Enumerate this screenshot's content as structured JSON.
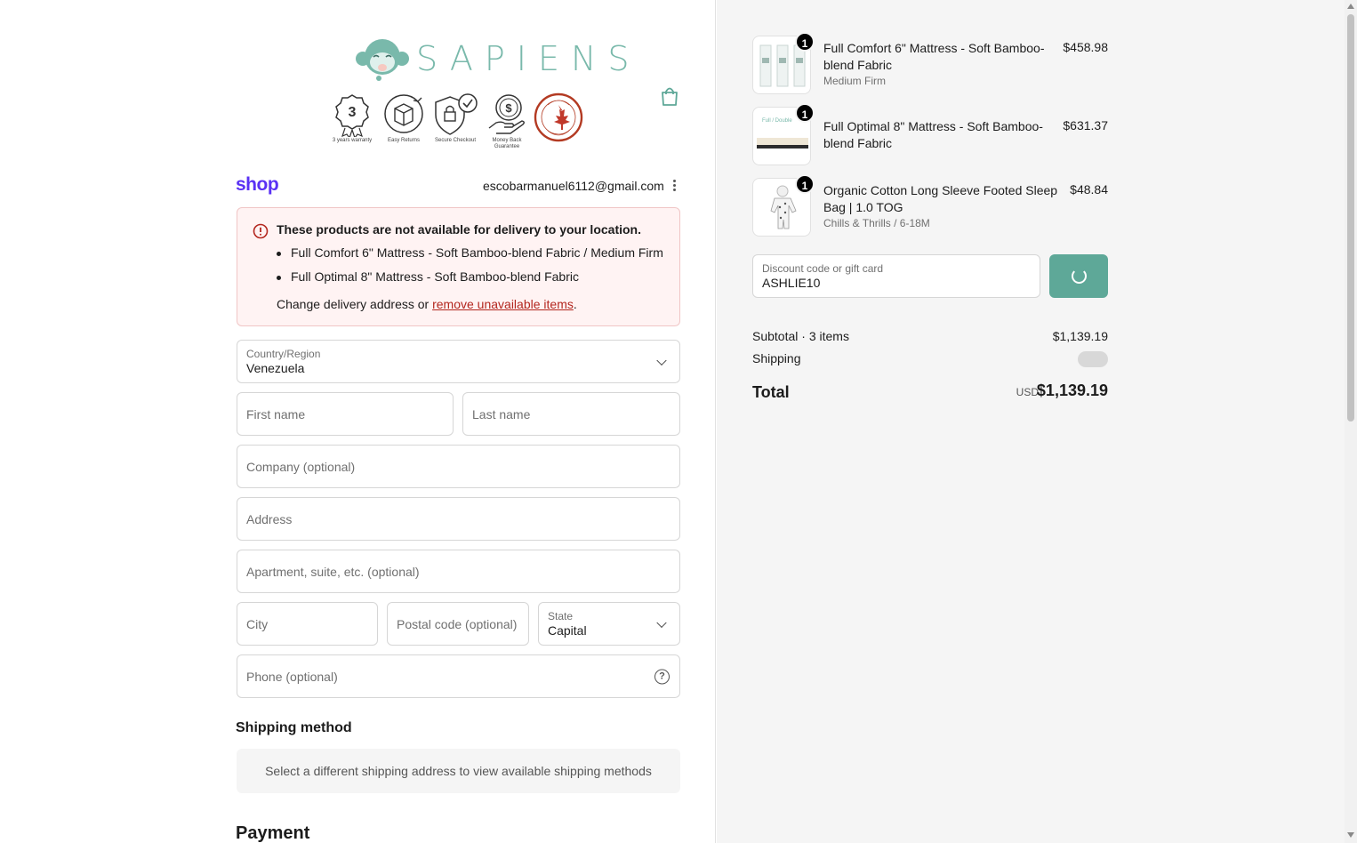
{
  "brand": {
    "name": "SAPIENS"
  },
  "badges": [
    {
      "icon": "warranty-ribbon-icon",
      "caption": "3 years warranty"
    },
    {
      "icon": "easy-returns-box-icon",
      "caption": "Easy Returns"
    },
    {
      "icon": "secure-checkout-shield-icon",
      "caption": "Secure Checkout"
    },
    {
      "icon": "money-back-hand-icon",
      "caption": "Money Back Guarantee"
    },
    {
      "icon": "made-in-canada-seal-icon",
      "caption": ""
    }
  ],
  "account": {
    "shop_label": "shop",
    "email": "escobarmanuel6112@gmail.com"
  },
  "alert": {
    "title": "These products are not available for delivery to your location.",
    "items": [
      "Full Comfort 6\" Mattress - Soft Bamboo-blend Fabric / Medium Firm",
      "Full Optimal 8\" Mattress - Soft Bamboo-blend Fabric"
    ],
    "footer_prefix": "Change delivery address or ",
    "footer_link": "remove unavailable items",
    "footer_suffix": "."
  },
  "form": {
    "country": {
      "label": "Country/Region",
      "value": "Venezuela"
    },
    "first_name": {
      "placeholder": "First name"
    },
    "last_name": {
      "placeholder": "Last name"
    },
    "company": {
      "placeholder": "Company (optional)"
    },
    "address": {
      "placeholder": "Address"
    },
    "apartment": {
      "placeholder": "Apartment, suite, etc. (optional)"
    },
    "city": {
      "placeholder": "City"
    },
    "postal": {
      "placeholder": "Postal code (optional)"
    },
    "state": {
      "label": "State",
      "value": "Capital"
    },
    "phone": {
      "placeholder": "Phone (optional)"
    }
  },
  "shipping_method": {
    "title": "Shipping method",
    "message": "Select a different shipping address to view available shipping methods"
  },
  "payment": {
    "title": "Payment"
  },
  "cart": {
    "items": [
      {
        "name": "Full Comfort 6\" Mattress - Soft Bamboo-blend Fabric",
        "variant": "Medium Firm",
        "price": "$458.98",
        "qty": "1"
      },
      {
        "name": "Full Optimal 8\" Mattress - Soft Bamboo-blend Fabric",
        "variant": "",
        "price": "$631.37",
        "qty": "1",
        "thumb_label": "Full / Double"
      },
      {
        "name": "Organic Cotton Long Sleeve Footed Sleep Bag | 1.0 TOG",
        "variant": "Chills & Thrills / 6-18M",
        "price": "$48.84",
        "qty": "1"
      }
    ],
    "discount": {
      "label": "Discount code or gift card",
      "value": "ASHLIE10"
    },
    "subtotal_label": "Subtotal · 3 items",
    "subtotal_value": "$1,139.19",
    "shipping_label": "Shipping",
    "total_label": "Total",
    "total_currency": "USD",
    "total_value": "$1,139.19"
  },
  "colors": {
    "accent": "#5ea898",
    "shop_purple": "#5a31f4",
    "error": "#b3261e",
    "brand_mint": "#79b9ab"
  }
}
